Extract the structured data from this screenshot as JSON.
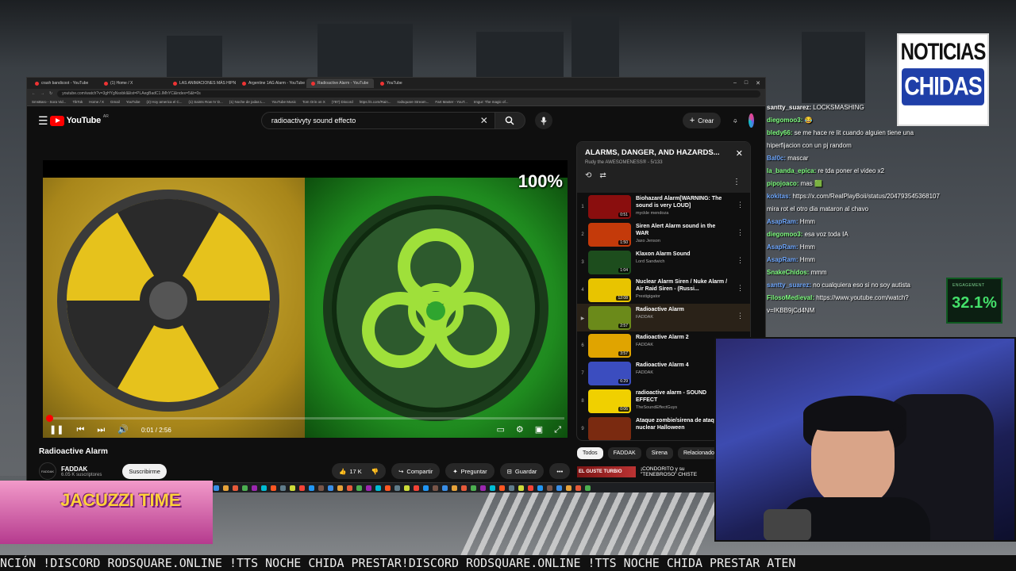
{
  "browser": {
    "tabs": [
      "crash bandicoot - YouTube",
      "(1) Home / X",
      "LAS ANIMACIONES MÁS HIPN",
      "Argentine 1AG Alarm - YouTube",
      "Radioactive Alarm - YouTube",
      "YouTube"
    ],
    "active_tab": 4,
    "url": "youtube.com/watch?v=3gHYgNsxbkl&list=PLAegBadC1.lMhYC&index=5&t=0s",
    "bookmarks": [
      "SmsBaro - Sora Vid...",
      "TikTok",
      "Home / X",
      "Gmail",
      "YouTube",
      "(2) Hoy america el C...",
      "(1) Saints Row IV D...",
      "(1) Noche de jodas L...",
      "YouTube Music",
      "Tom Orin on X",
      "(787) Discord",
      "https://s.com/Rain...",
      "rodsquare Stream...",
      "Fart Master - YouT...",
      "Imgur: The magic of..."
    ]
  },
  "youtube": {
    "logo_text": "YouTube",
    "logo_region": "AR",
    "search_value": "radioactivyty sound effecto",
    "create_label": "Crear"
  },
  "player": {
    "percent_overlay": "100%",
    "time": "0:01 / 2:56",
    "progress_fraction": 0.006
  },
  "video": {
    "title": "Radioactive Alarm",
    "channel": "FADDAK",
    "channel_avatar_text": "FADDAK",
    "subscribers": "6.05 K suscriptores",
    "subscribe_label": "Suscribirme",
    "likes": "17 K",
    "share_label": "Compartir",
    "ask_label": "Preguntar",
    "save_label": "Guardar"
  },
  "playlist": {
    "title": "ALARMS, DANGER, AND HAZARDS...",
    "subtitle": "Rudy the AWESOMENESS® - 5/133",
    "items": [
      {
        "index": "1",
        "title": "Biohazard Alarm[WARNING: The sound is very LOUD]",
        "author": "myckle mendoza",
        "duration": "0:51",
        "color": "#8a0e0e"
      },
      {
        "index": "2",
        "title": "Siren Alert Alarm sound in the WAR",
        "author": "Jaxo Jenson",
        "duration": "1:50",
        "color": "#c43a0a"
      },
      {
        "index": "3",
        "title": "Klaxon Alarm Sound",
        "author": "Lord Sandwich",
        "duration": "1:04",
        "color": "#1d4d1d"
      },
      {
        "index": "4",
        "title": "Nuclear Alarm Siren / Nuke Alarm / Air Raid Siren - (Russi...",
        "author": "Prestigigator",
        "duration": "12:08",
        "color": "#e8c400"
      },
      {
        "index": "▶",
        "title": "Radioactive Alarm",
        "author": "FADDAK",
        "duration": "2:57",
        "color": "#6b8a1a"
      },
      {
        "index": "6",
        "title": "Radioactive Alarm 2",
        "author": "FADDAK",
        "duration": "3:57",
        "color": "#e0a400"
      },
      {
        "index": "7",
        "title": "Radioactive Alarm 4",
        "author": "FADDAK",
        "duration": "6:29",
        "color": "#3b4dbf"
      },
      {
        "index": "8",
        "title": "radioactive alarm - SOUND EFFECT",
        "author": "TheSoundEffectGuys",
        "duration": "0:06",
        "color": "#f0d000"
      },
      {
        "index": "9",
        "title": "Ataque zombie/sirena de ataque nuclear Halloween",
        "author": "",
        "duration": "",
        "color": "#7a2a10"
      }
    ]
  },
  "chips": [
    "Todos",
    "FADDAK",
    "Sirena",
    "Relacionado"
  ],
  "next_video": {
    "thumb_text": "EL GUSTE TURBIO",
    "title": "¡CONDORITO y su \"TENEBROSO\" CHISTE"
  },
  "chat": [
    {
      "user": "santty_suarez:",
      "msg": "LOCKSMASHING",
      "color": "#ffffff"
    },
    {
      "user": "diegomoo3:",
      "msg": "😂",
      "color": "#7fff7f"
    },
    {
      "user": "bledy66:",
      "msg": "se me hace re lit cuando alguien tiene una",
      "color": "#7fff7f"
    },
    {
      "user": "",
      "msg": "hiperfijacion con un pj random",
      "color": "#ffffff"
    },
    {
      "user": "Bal0c:",
      "msg": "mascar",
      "color": "#6fa8ff"
    },
    {
      "user": "la_banda_epica:",
      "msg": "re tda poner el video x2",
      "color": "#7fff7f"
    },
    {
      "user": "pipojoaco:",
      "msg": "mas 🟩",
      "color": "#7fff7f"
    },
    {
      "user": "kokitas:",
      "msg": "https://x.com/RealPlayBoii/status/204793545368107",
      "color": "#6fa8ff"
    },
    {
      "user": "",
      "msg": "mira rot el otro dia mataron al chavo",
      "color": "#ffffff"
    },
    {
      "user": "AsapRam:",
      "msg": "Hmm",
      "color": "#6fa8ff"
    },
    {
      "user": "diegomoo3:",
      "msg": "esa voz toda IA",
      "color": "#7fff7f"
    },
    {
      "user": "AsapRam:",
      "msg": "Hmm",
      "color": "#6fa8ff"
    },
    {
      "user": "AsapRam:",
      "msg": "Hmm",
      "color": "#6fa8ff"
    },
    {
      "user": "SnakeChidos:",
      "msg": "mmm",
      "color": "#7fff7f"
    },
    {
      "user": "santty_suarez:",
      "msg": "no cualquiera eso si no soy autista",
      "color": "#6fa8ff"
    },
    {
      "user": "FilosoMedieval:",
      "msg": "https://www.youtube.com/watch?",
      "color": "#7fff7f"
    },
    {
      "user": "",
      "msg": "v=IKBB9jCd4NM",
      "color": "#ffffff"
    }
  ],
  "noticias": {
    "line1": "NOTICIAS",
    "line2": "CHIDAS"
  },
  "engagement": {
    "label": "ENGAGEMENT",
    "value": "32.1%"
  },
  "game": {
    "title": "JACUZZI TIME"
  },
  "ticker": "NCIÓN !DISCORD RODSQUARE.ONLINE !TTS NOCHE CHIDA PRESTAR!DISCORD RODSQUARE.ONLINE !TTS NOCHE CHIDA PRESTAR ATEN"
}
